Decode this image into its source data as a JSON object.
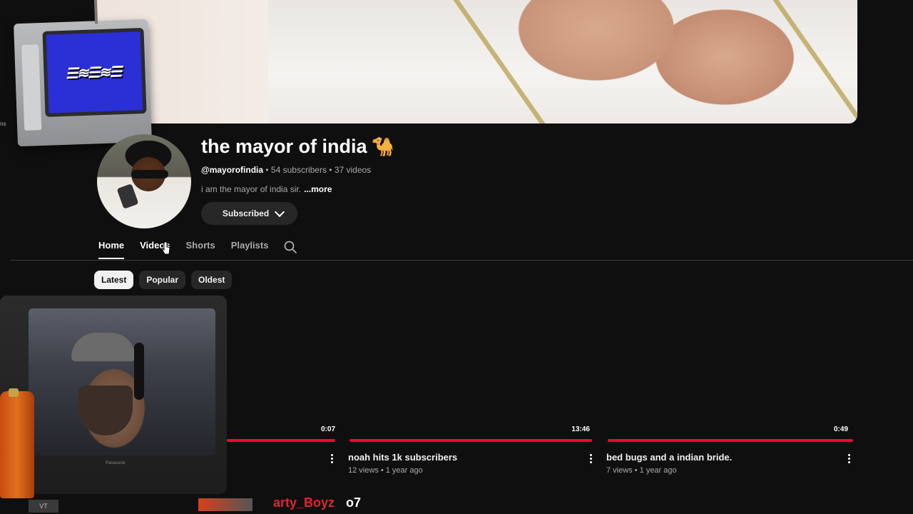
{
  "channel": {
    "name": "the mayor of india",
    "emoji": "🐪",
    "handle": "@mayorofindia",
    "stats": " • 54 subscribers • 37 videos",
    "description": "i am the mayor of india sir.",
    "more_label": "...more",
    "subscribe_label": "Subscribed"
  },
  "tabs": [
    {
      "label": "Home",
      "active": true
    },
    {
      "label": "Videos",
      "active": false
    },
    {
      "label": "Shorts",
      "active": false
    },
    {
      "label": "Playlists",
      "active": false
    }
  ],
  "chips": [
    {
      "label": "Latest",
      "active": true
    },
    {
      "label": "Popular",
      "active": false
    },
    {
      "label": "Oldest",
      "active": false
    }
  ],
  "videos": [
    {
      "duration": "0:07",
      "title": "",
      "views": "",
      "age": "",
      "watched_fraction": 1.0
    },
    {
      "duration": "13:46",
      "title": "noah hits 1k subscribers",
      "views": "12 views",
      "age": "1 year ago",
      "meta": "12 views • 1 year ago",
      "watched_fraction": 1.0
    },
    {
      "duration": "0:49",
      "title": "bed bugs and a indian bride.",
      "views": "7 views",
      "age": "1 year ago",
      "meta": "7 views • 1 year ago",
      "watched_fraction": 1.0
    }
  ],
  "overlay": {
    "left_edge_text": "ns",
    "vt_label": "VT",
    "chat_user": "arty_Boyz",
    "chat_message": "o7",
    "webcam_brand": "Panasonic"
  },
  "colors": {
    "background": "#0f0f0f",
    "accent_red": "#ff0033",
    "chat_user": "#e0262f"
  }
}
